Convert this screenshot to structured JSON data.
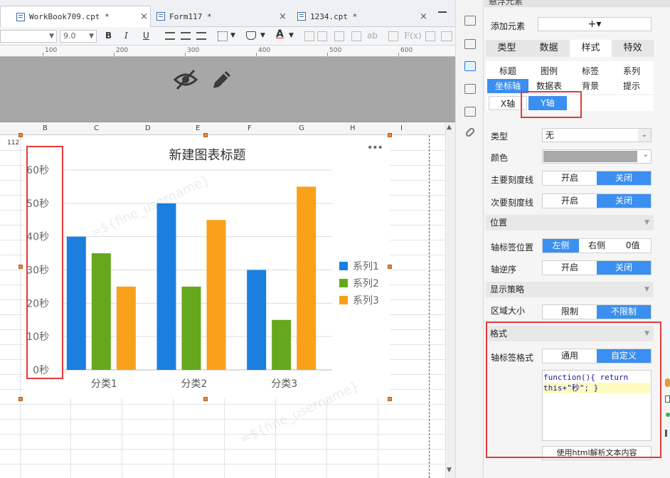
{
  "tabs": [
    {
      "title": "WorkBook709.cpt *",
      "close": "×"
    },
    {
      "title": "Form117 *",
      "close": "×"
    },
    {
      "title": "1234.cpt *",
      "close": "×"
    }
  ],
  "toolbar": {
    "font_size": "9.0",
    "bold": "B",
    "italic": "I",
    "underline": "U",
    "font_color_label": "A",
    "text_ab": "ab",
    "formula": "F(x)"
  },
  "ruler": [
    "100",
    "200",
    "300",
    "400",
    "500",
    "600"
  ],
  "columns": [
    "B",
    "C",
    "D",
    "E",
    "F",
    "G",
    "H",
    "I"
  ],
  "cell_value": "112",
  "watermark": "=${fine_username}",
  "chart_data": {
    "type": "bar",
    "title": "新建图表标题",
    "categories": [
      "分类1",
      "分类2",
      "分类3"
    ],
    "series": [
      {
        "name": "系列1",
        "values": [
          40,
          50,
          30
        ],
        "color": "#1b7fe0"
      },
      {
        "name": "系列2",
        "values": [
          35,
          25,
          15
        ],
        "color": "#66a81c"
      },
      {
        "name": "系列3",
        "values": [
          25,
          45,
          55
        ],
        "color": "#f9a11b"
      }
    ],
    "y_ticks": [
      "0秒",
      "10秒",
      "20秒",
      "30秒",
      "40秒",
      "50秒",
      "60秒"
    ],
    "ylim": [
      0,
      60
    ],
    "legend_position": "right",
    "menu": "•••"
  },
  "panel": {
    "header": "悬浮元素",
    "add_element_label": "添加元素",
    "add_element_btn": "+▾",
    "main_tabs": [
      "类型",
      "数据",
      "样式",
      "特效"
    ],
    "sub_tabs_row1": [
      "标题",
      "图例",
      "标签",
      "系列"
    ],
    "sub_tabs_row2": [
      "坐标轴",
      "数据表",
      "背景",
      "提示"
    ],
    "axis_tabs": [
      "X轴",
      "Y轴"
    ],
    "type_label": "类型",
    "type_value": "无",
    "color_label": "颜色",
    "major_tick_label": "主要刻度线",
    "minor_tick_label": "次要刻度线",
    "on": "开启",
    "off": "关闭",
    "position_section": "位置",
    "axis_label_pos_label": "轴标签位置",
    "axis_label_pos_opts": [
      "左侧",
      "右侧",
      "0值"
    ],
    "axis_reverse_label": "轴逆序",
    "display_section": "显示策略",
    "area_size_label": "区域大小",
    "area_size_opts": [
      "限制",
      "不限制"
    ],
    "format_section": "格式",
    "axis_label_fmt_label": "轴标签格式",
    "axis_label_fmt_opts": [
      "通用",
      "自定义"
    ],
    "code_line1": "function(){ return",
    "code_line2": "this+\"秒\"; }",
    "html_parse_btn": "使用html解析文本内容"
  }
}
